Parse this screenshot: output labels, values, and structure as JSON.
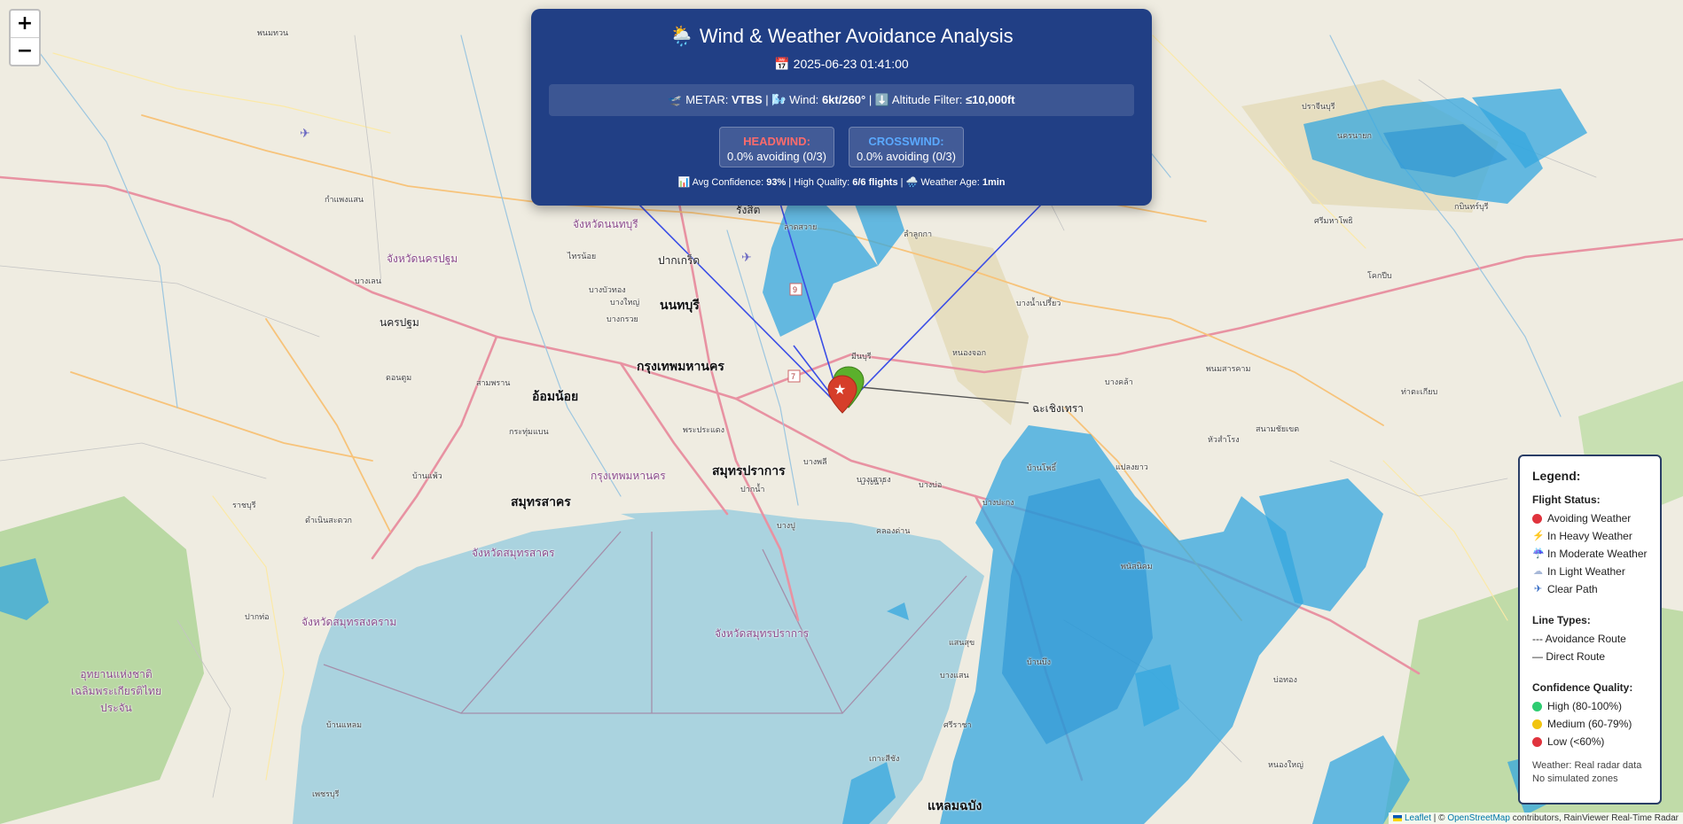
{
  "map": {
    "zoom_in": "+",
    "zoom_out": "−",
    "places": [
      {
        "name": "กรุงเทพมหานคร",
        "cls": "big"
      },
      {
        "name": "นนทบุรี",
        "cls": "big"
      },
      {
        "name": "ปากเกร็ด",
        "cls": "mid"
      },
      {
        "name": "สมุทรปราการ",
        "cls": "big"
      },
      {
        "name": "สมุทรสาคร",
        "cls": "big"
      },
      {
        "name": "นครปฐม",
        "cls": "mid"
      },
      {
        "name": "อ้อมน้อย",
        "cls": "big"
      },
      {
        "name": "จังหวัดนครปฐม",
        "cls": "prov"
      },
      {
        "name": "จังหวัดนนทบุรี",
        "cls": "prov"
      },
      {
        "name": "จังหวัดสมุทรสาคร",
        "cls": "prov"
      },
      {
        "name": "จังหวัดสมุทรสงคราม",
        "cls": "prov"
      },
      {
        "name": "จังหวัดสมุทรปราการ",
        "cls": "prov"
      },
      {
        "name": "กรุงเทพมหานคร",
        "cls": "prov"
      },
      {
        "name": "ฉะเชิงเทรา",
        "cls": "mid"
      },
      {
        "name": "แหลมฉบัง",
        "cls": "big"
      },
      {
        "name": "บางพลี",
        "cls": "small"
      },
      {
        "name": "บางบ่อ",
        "cls": "small"
      },
      {
        "name": "บ้านโพธิ์",
        "cls": "small"
      },
      {
        "name": "พนัสนิคม",
        "cls": "small"
      },
      {
        "name": "บ้านบึง",
        "cls": "small"
      },
      {
        "name": "ศรีราชา",
        "cls": "small"
      },
      {
        "name": "บางปะกง",
        "cls": "small"
      },
      {
        "name": "บางนา",
        "cls": "small"
      },
      {
        "name": "ปทุมธานี",
        "cls": "small"
      },
      {
        "name": "รังสิต",
        "cls": "mid"
      },
      {
        "name": "ลาดสวาย",
        "cls": "small"
      },
      {
        "name": "ธัญบุรี",
        "cls": "small"
      },
      {
        "name": "ลำลูกกา",
        "cls": "small"
      },
      {
        "name": "ปราจีนบุรี",
        "cls": "small"
      },
      {
        "name": "นครนายก",
        "cls": "small"
      },
      {
        "name": "ศรีมหาโพธิ",
        "cls": "small"
      },
      {
        "name": "พนมทวน",
        "cls": "small"
      },
      {
        "name": "กำแพงแสน",
        "cls": "small"
      },
      {
        "name": "บางเลน",
        "cls": "small"
      },
      {
        "name": "ดอนตูม",
        "cls": "small"
      },
      {
        "name": "สามพราน",
        "cls": "small"
      },
      {
        "name": "บ้านแพ้ว",
        "cls": "small"
      },
      {
        "name": "กระทุ่มแบน",
        "cls": "small"
      },
      {
        "name": "พระประแดง",
        "cls": "small"
      },
      {
        "name": "ปากน้ำ",
        "cls": "small"
      },
      {
        "name": "บางเสาธง",
        "cls": "small"
      },
      {
        "name": "บางบัวทอง",
        "cls": "small"
      },
      {
        "name": "ไทรน้อย",
        "cls": "small"
      },
      {
        "name": "บางใหญ่",
        "cls": "small"
      },
      {
        "name": "บางกรวย",
        "cls": "small"
      },
      {
        "name": "หนองจอก",
        "cls": "small"
      },
      {
        "name": "มีนบุรี",
        "cls": "small"
      },
      {
        "name": "คลองหลวง",
        "cls": "small"
      },
      {
        "name": "บางคล้า",
        "cls": "small"
      },
      {
        "name": "บางน้ำเปรี้ยว",
        "cls": "small"
      },
      {
        "name": "ราชบุรี",
        "cls": "small"
      },
      {
        "name": "ดำเนินสะดวก",
        "cls": "small"
      },
      {
        "name": "ปากท่อ",
        "cls": "small"
      },
      {
        "name": "อุทยานแห่งชาติเฉลิมพระเกียรติไทยประจัน",
        "cls": "prov"
      },
      {
        "name": "บ้านแหลม",
        "cls": "small"
      },
      {
        "name": "เพชรบุรี",
        "cls": "small"
      },
      {
        "name": "แสนสุข",
        "cls": "small"
      },
      {
        "name": "บางแสน",
        "cls": "small"
      },
      {
        "name": "หนองใหญ่",
        "cls": "small"
      },
      {
        "name": "บ่อทอง",
        "cls": "small"
      },
      {
        "name": "เกาะสีชัง",
        "cls": "small"
      },
      {
        "name": "กบินทร์บุรี",
        "cls": "small"
      },
      {
        "name": "ศรีราชา",
        "cls": "small"
      },
      {
        "name": "พนมสารคาม",
        "cls": "small"
      },
      {
        "name": "สนามชัยเขต",
        "cls": "small"
      },
      {
        "name": "แปลงยาว",
        "cls": "small"
      },
      {
        "name": "หัวสำโรง",
        "cls": "small"
      },
      {
        "name": "โคกปีบ",
        "cls": "small"
      },
      {
        "name": "กบินทร์",
        "cls": "small"
      },
      {
        "name": "ท่าตะเกียบ",
        "cls": "small"
      },
      {
        "name": "บางปู",
        "cls": "small"
      },
      {
        "name": "คลองด่าน",
        "cls": "small"
      }
    ]
  },
  "panel": {
    "title_icon": "🌦️",
    "title": "Wind & Weather Avoidance Analysis",
    "date_icon": "📅",
    "date": "2025-06-23 01:41:00",
    "metar_prefix": "🛫 METAR:",
    "metar_station": "VTBS",
    "wind_label": "| 🌬️ Wind:",
    "wind_value": "6kt/260°",
    "alt_label": "| ⬇️ Altitude Filter:",
    "alt_value": "≤10,000ft",
    "headwind_title": "HEADWIND:",
    "headwind_value": "0.0% avoiding (0/3)",
    "crosswind_title": "CROSSWIND:",
    "crosswind_value": "0.0% avoiding (0/3)",
    "conf_prefix": "📊 Avg Confidence:",
    "conf_value": "93%",
    "hq_label": "| High Quality:",
    "hq_value": "6/6 flights",
    "age_label": "| 🌧️ Weather Age:",
    "age_value": "1min",
    "colors": {
      "headwind": "#ff6b6b",
      "crosswind": "#5aa9ff",
      "panel_bg": "#213f85"
    }
  },
  "legend": {
    "title": "Legend:",
    "flight_status_title": "Flight Status:",
    "flight_status": [
      {
        "icon": "red-circle",
        "label": "Avoiding Weather",
        "color": "#e0333d"
      },
      {
        "icon": "lightning",
        "label": "In Heavy Weather",
        "color": "#f0a000"
      },
      {
        "icon": "rain-cloud",
        "label": "In Moderate Weather",
        "color": "#6b8cd6"
      },
      {
        "icon": "cloud",
        "label": "In Light Weather",
        "color": "#a7b8d8"
      },
      {
        "icon": "airplane",
        "label": "Clear Path",
        "color": "#3a6fc6"
      }
    ],
    "line_types_title": "Line Types:",
    "line_types": [
      "--- Avoidance Route",
      "— Direct Route"
    ],
    "confidence_title": "Confidence Quality:",
    "confidence": [
      {
        "label": "High (80-100%)",
        "color": "#2ecc71"
      },
      {
        "label": "Medium (60-79%)",
        "color": "#f1c40f"
      },
      {
        "label": "Low (<60%)",
        "color": "#e0333d"
      }
    ],
    "foot1": "Weather: Real radar data",
    "foot2": "No simulated zones"
  },
  "attribution": {
    "leaflet": "Leaflet",
    "sep": "| ©",
    "osm": "OpenStreetMap",
    "rest": "contributors, RainViewer Real-Time Radar"
  }
}
